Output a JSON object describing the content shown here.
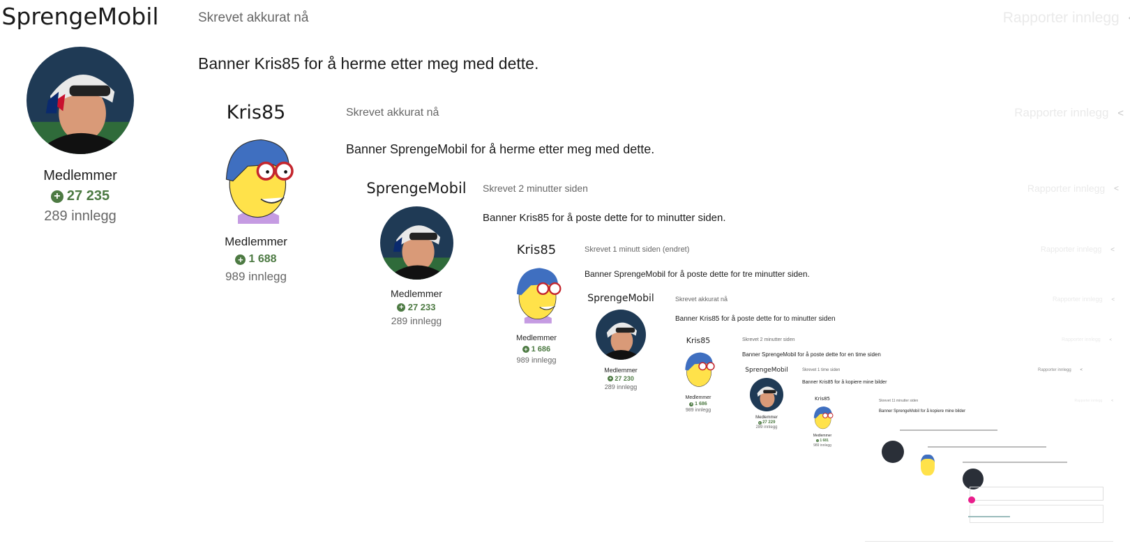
{
  "posts": [
    {
      "author": "SprengeMobil",
      "group": "Medlemmer",
      "reputation": "27 235",
      "post_count": "289 innlegg",
      "posted": "Skrevet akkurat nå",
      "report": "Rapporter innlegg",
      "content": "Banner Kris85 for å herme etter meg med dette.",
      "avatar": "skier"
    },
    {
      "author": "Kris85",
      "group": "Medlemmer",
      "reputation": "1 688",
      "post_count": "989 innlegg",
      "posted": "Skrevet akkurat nå",
      "report": "Rapporter innlegg",
      "content": "Banner SprengeMobil for å herme etter meg med dette.",
      "avatar": "cartoon"
    },
    {
      "author": "SprengeMobil",
      "group": "Medlemmer",
      "reputation": "27 233",
      "post_count": "289 innlegg",
      "posted": "Skrevet 2 minutter siden",
      "report": "Rapporter innlegg",
      "content": "Banner Kris85 for å poste dette for to minutter siden.",
      "avatar": "skier"
    },
    {
      "author": "Kris85",
      "group": "Medlemmer",
      "reputation": "1 686",
      "post_count": "989 innlegg",
      "posted": "Skrevet 1 minutt siden (endret)",
      "report": "Rapporter innlegg",
      "content": "Banner SprengeMobil for å poste dette for tre minutter siden.",
      "avatar": "cartoon"
    },
    {
      "author": "SprengeMobil",
      "group": "Medlemmer",
      "reputation": "27 230",
      "post_count": "289 innlegg",
      "posted": "Skrevet akkurat nå",
      "report": "Rapporter innlegg",
      "content": "Banner Kris85 for å poste dette for to minutter siden",
      "avatar": "skier"
    },
    {
      "author": "Kris85",
      "group": "Medlemmer",
      "reputation": "1 686",
      "post_count": "989 innlegg",
      "posted": "Skrevet 2 minutter siden",
      "report": "Rapporter innlegg",
      "content": "Banner SprengeMobil for å poste dette for en time siden",
      "avatar": "cartoon"
    },
    {
      "author": "SprengeMobil",
      "group": "Medlemmer",
      "reputation": "27 229",
      "post_count": "289 innlegg",
      "posted": "Skrevet 1 time siden",
      "report": "Rapporter innlegg",
      "content": "Banner Kris85 for å kopiere mine bilder",
      "avatar": "skier"
    },
    {
      "author": "Kris85",
      "group": "Medlemmer",
      "reputation": "1 681",
      "post_count": "989 innlegg",
      "posted": "Skrevet 11 minutter siden",
      "report": "Rapporter innlegg",
      "content": "Banner SprengeMobil for å kopiere mine bilder",
      "avatar": "cartoon"
    }
  ],
  "colors": {
    "reputation": "#4d7a43",
    "muted": "#666666",
    "faint": "#eaeaea",
    "accent_dot": "#e91e8c"
  }
}
